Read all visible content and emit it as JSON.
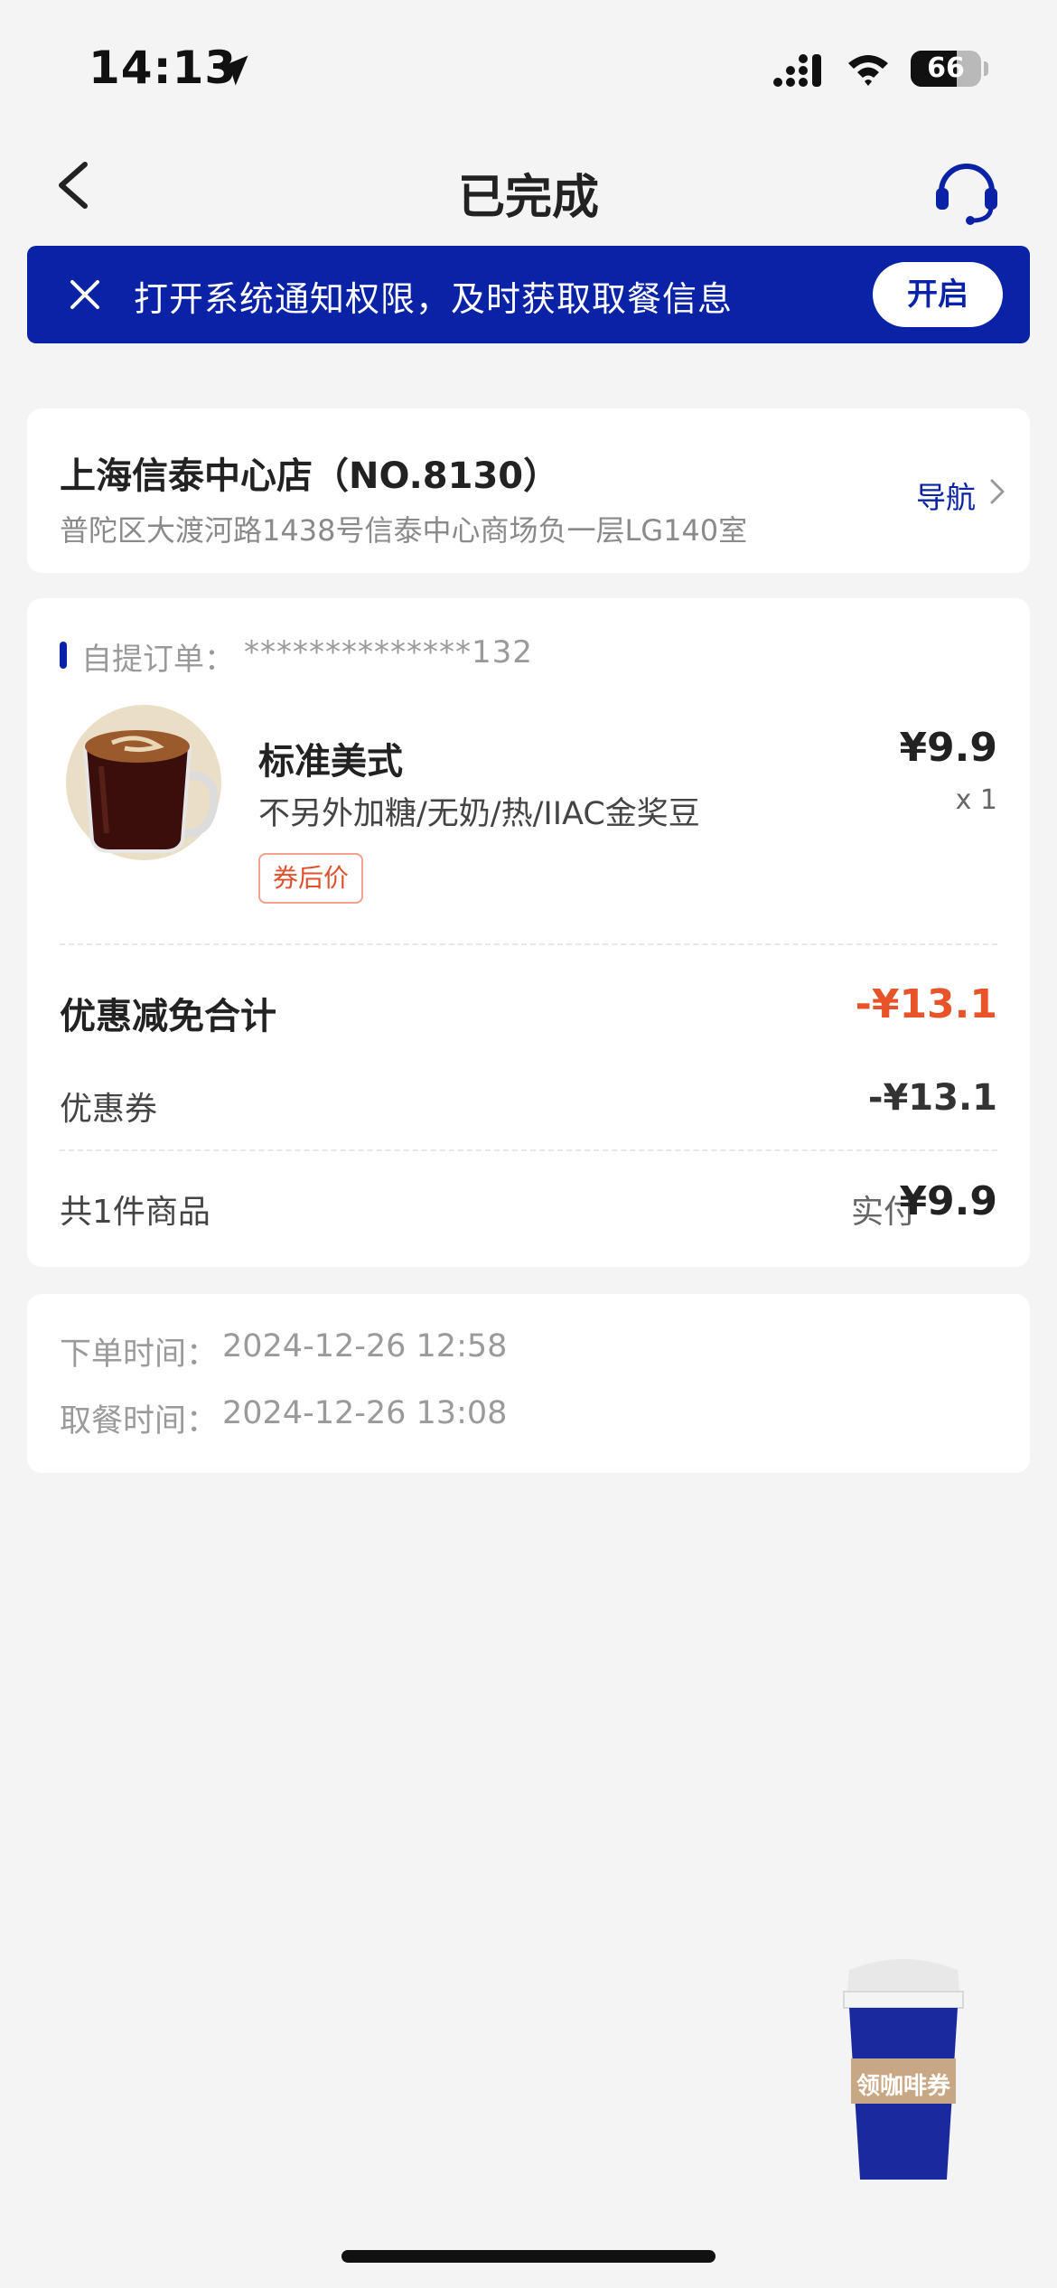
{
  "status_bar": {
    "time": "14:13",
    "battery": "66"
  },
  "nav": {
    "title": "已完成"
  },
  "banner": {
    "text": "打开系统通知权限，及时获取取餐信息",
    "button": "开启",
    "color": "#0a22a6"
  },
  "store": {
    "name": "上海信泰中心店（NO.8130）",
    "address": "普陀区大渡河路1438号信泰中心商场负一层LG140室",
    "nav_label": "导航"
  },
  "order": {
    "label": "自提订单：",
    "number": "**************132",
    "item": {
      "name": "标准美式",
      "spec": "不另外加糖/无奶/热/IIAC金奖豆",
      "tag": "券后价",
      "price": "¥9.9",
      "quantity": "x 1"
    },
    "discount_label": "优惠减免合计",
    "discount_total": "-¥13.1",
    "coupon_label": "优惠券",
    "coupon_value": "-¥13.1",
    "items_count": "共1件商品",
    "paid_label": "实付",
    "paid_value": "¥9.9"
  },
  "times": {
    "order_time_label": "下单时间：",
    "order_time": "2024-12-26 12:58",
    "pickup_time_label": "取餐时间：",
    "pickup_time": "2024-12-26 13:08"
  },
  "floating": {
    "coupon_text": "领咖啡券"
  },
  "colors": {
    "accent": "#0a22a6",
    "discount": "#e8542a",
    "background": "#f4f4f4"
  }
}
